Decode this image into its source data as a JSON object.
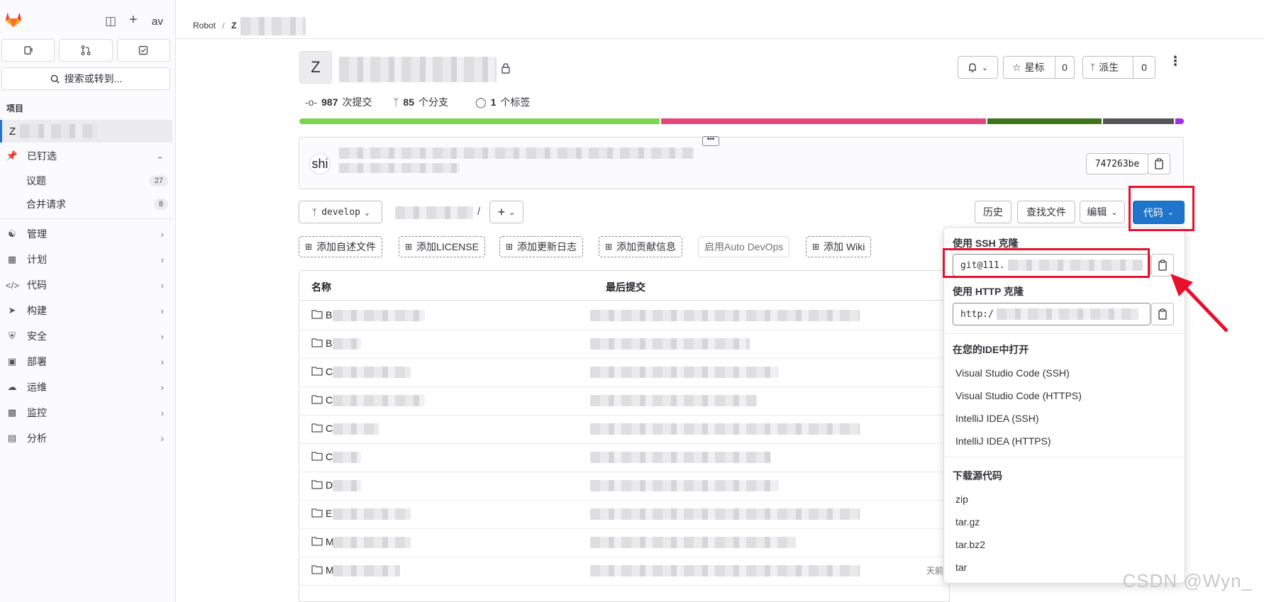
{
  "sidebar": {
    "user_initials": "av",
    "search_label": "搜索或转到...",
    "section_heading": "项目",
    "project_initial": "Z",
    "pinned_label": "已钉选",
    "pinned_items": [
      {
        "label": "议题",
        "count": "27"
      },
      {
        "label": "合并请求",
        "count": "8"
      }
    ],
    "nav_items": [
      {
        "label": "管理",
        "icon": "users-icon"
      },
      {
        "label": "计划",
        "icon": "calendar-icon"
      },
      {
        "label": "代码",
        "icon": "code-icon"
      },
      {
        "label": "构建",
        "icon": "rocket-icon"
      },
      {
        "label": "安全",
        "icon": "shield-icon"
      },
      {
        "label": "部署",
        "icon": "deploy-icon"
      },
      {
        "label": "运维",
        "icon": "cloud-icon"
      },
      {
        "label": "监控",
        "icon": "monitor-icon"
      },
      {
        "label": "分析",
        "icon": "chart-icon"
      }
    ]
  },
  "breadcrumb": {
    "root": "Robot",
    "separator": "/",
    "project": "Z"
  },
  "project": {
    "avatar_letter": "Z",
    "star_label": "星标",
    "star_count": "0",
    "fork_label": "派生",
    "fork_count": "0",
    "commits_count": "987",
    "commits_label": "次提交",
    "branches_count": "85",
    "branches_label": "个分支",
    "tags_count": "1",
    "tags_label": "个标签"
  },
  "language_bar": [
    {
      "color": "#7bd64f",
      "share": 41
    },
    {
      "color": "#e6457a",
      "share": 37
    },
    {
      "color": "#3f7418",
      "share": 13
    },
    {
      "color": "#555559",
      "share": 8
    },
    {
      "color": "#a52ce0",
      "share": 1
    }
  ],
  "commit": {
    "avatar_text": "shi",
    "sha": "747263be"
  },
  "toolbar": {
    "branch": "develop",
    "path_separator": "/",
    "history": "历史",
    "find_file": "查找文件",
    "edit": "编辑",
    "code": "代码"
  },
  "quick_actions": [
    "添加自述文件",
    "添加LICENSE",
    "添加更新日志",
    "添加贡献信息",
    "启用Auto DevOps",
    "添加 Wiki"
  ],
  "table": {
    "col_name": "名称",
    "col_last_commit": "最后提交",
    "rows": [
      "B",
      "B",
      "C",
      "C",
      "C",
      "C",
      "D",
      "E",
      "M",
      "M"
    ],
    "last_row_time_hint": "天前"
  },
  "clone_dropdown": {
    "ssh_heading": "使用 SSH 克隆",
    "ssh_url": "git@111.",
    "http_heading": "使用 HTTP 克隆",
    "http_url": "http:/",
    "ide_heading": "在您的IDE中打开",
    "ide_items": [
      "Visual Studio Code (SSH)",
      "Visual Studio Code (HTTPS)",
      "IntelliJ IDEA (SSH)",
      "IntelliJ IDEA (HTTPS)"
    ],
    "download_heading": "下载源代码",
    "download_items": [
      "zip",
      "tar.gz",
      "tar.bz2",
      "tar"
    ]
  },
  "watermark": "CSDN @Wyn_"
}
